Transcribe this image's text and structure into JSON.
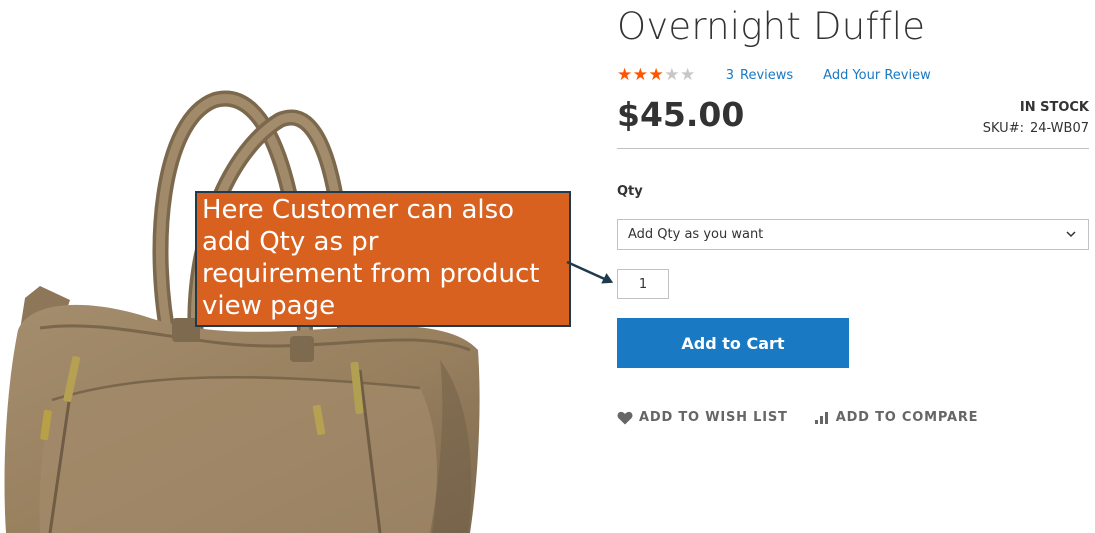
{
  "product": {
    "name": "Overnight Duffle",
    "rating": {
      "value": 3,
      "max": 5,
      "stars_on": "★★★",
      "stars_off": "★★",
      "review_count": "3",
      "reviews_label": "Reviews",
      "add_review_label": "Add Your Review"
    },
    "price": "$45.00",
    "stock_status": "IN STOCK",
    "sku_label": "SKU#:",
    "sku": "24-WB07"
  },
  "form": {
    "qty_label": "Qty",
    "qty_select_value": "Add Qty as you want",
    "qty_input_value": "1",
    "add_to_cart_label": "Add to Cart"
  },
  "actions": {
    "wishlist_label": "Add to Wish List",
    "compare_label": "Add to Compare"
  },
  "annotation": {
    "text": "Here Customer can also\nadd Qty as pr\nrequirement from product\nview page"
  },
  "colors": {
    "accent": "#1979c3",
    "star_on": "#ff5501",
    "star_off": "#c7c7c7",
    "callout_bg": "#d96120",
    "callout_border": "#1f3a4d",
    "bag": "#9c8566"
  },
  "icons": {
    "select_chevron": "chevron-down-icon",
    "wishlist": "heart-icon",
    "compare": "bar-chart-icon"
  }
}
